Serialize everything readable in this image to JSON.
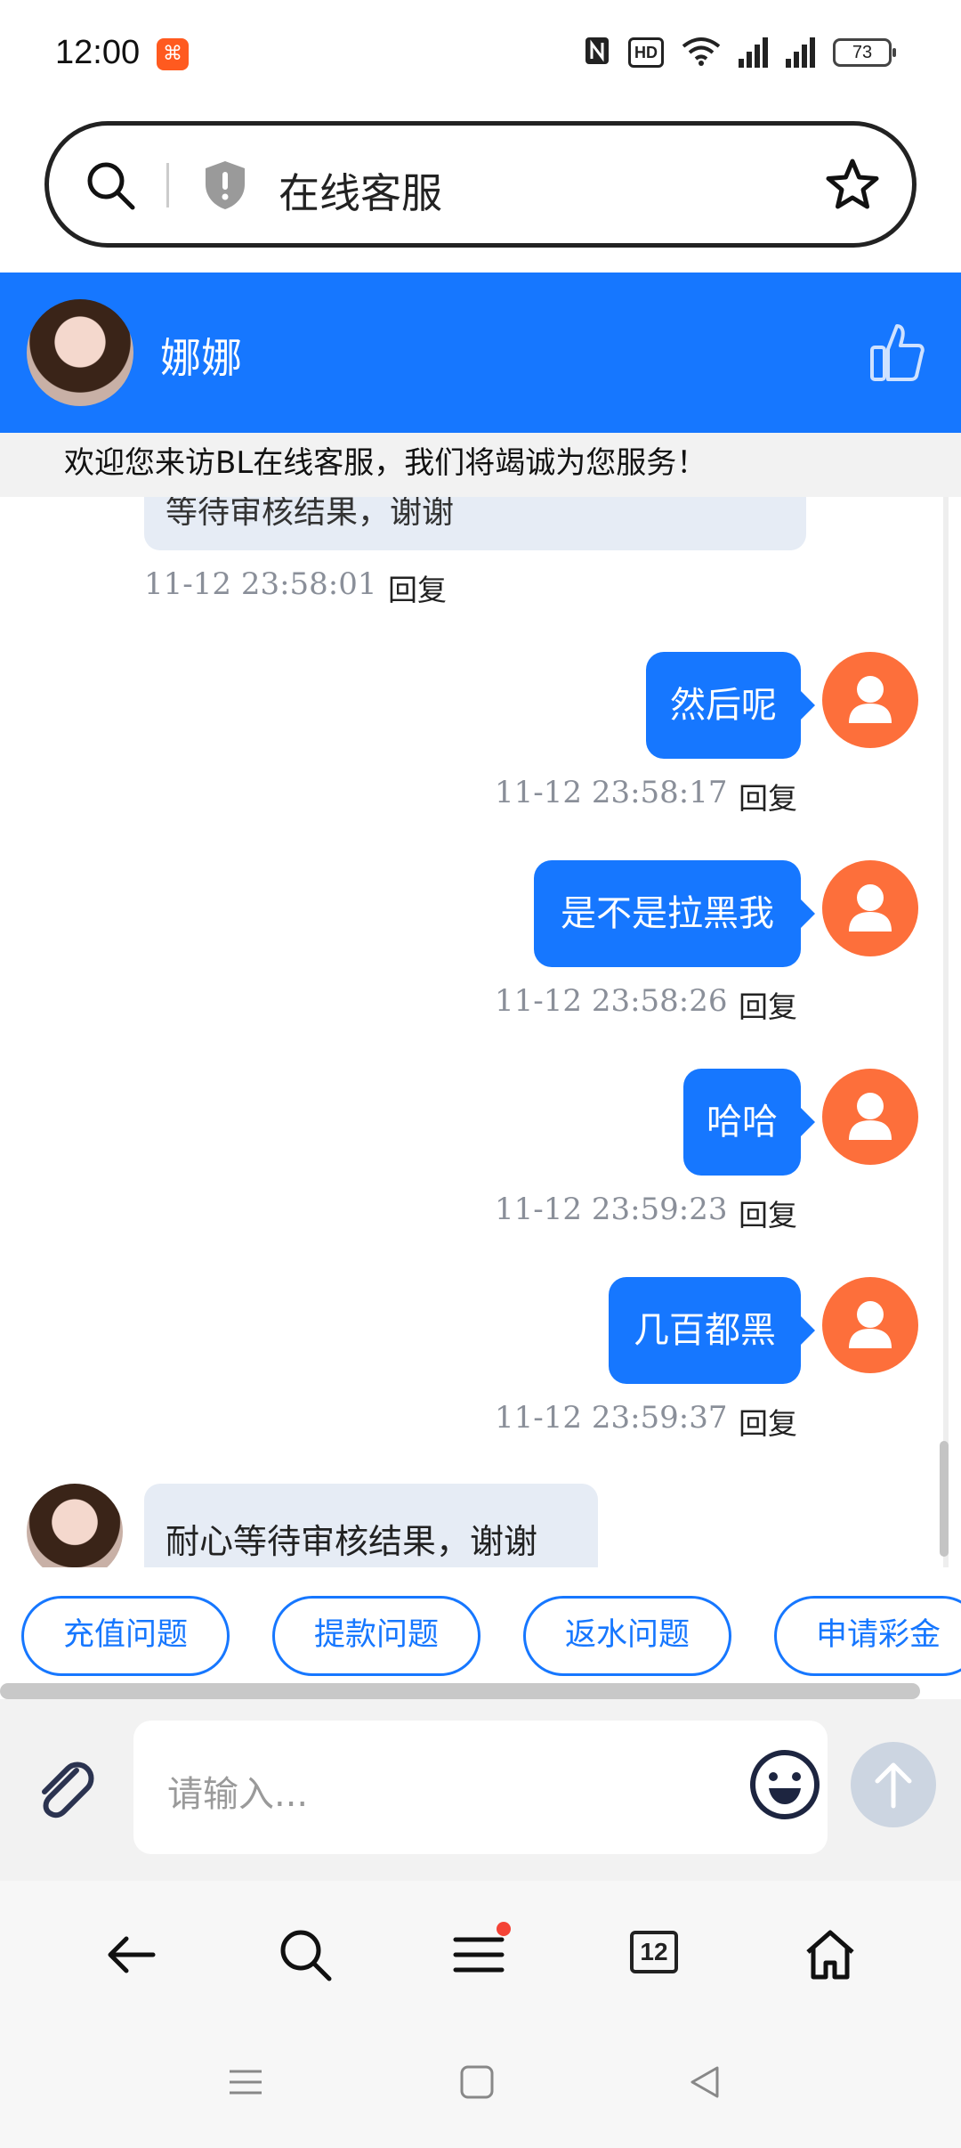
{
  "status_bar": {
    "time": "12:00",
    "hd_label": "HD",
    "battery": "73"
  },
  "address_bar": {
    "title": "在线客服"
  },
  "chat_header": {
    "agent_name": "娜娜"
  },
  "welcome_text": "欢迎您来访BL在线客服，我们将竭诚为您服务！",
  "partial_message": {
    "text": "等待审核结果，谢谢",
    "timestamp": "11-12 23:58:01",
    "reply_label": "回复"
  },
  "messages": [
    {
      "text": "然后呢",
      "timestamp": "11-12 23:58:17",
      "reply_label": "回复"
    },
    {
      "text": "是不是拉黑我",
      "timestamp": "11-12 23:58:26",
      "reply_label": "回复"
    },
    {
      "text": "哈哈",
      "timestamp": "11-12 23:59:23",
      "reply_label": "回复"
    },
    {
      "text": "几百都黑",
      "timestamp": "11-12 23:59:37",
      "reply_label": "回复"
    }
  ],
  "incoming_last": {
    "text": "耐心等待审核结果，谢谢"
  },
  "quick_replies": [
    "充值问题",
    "提款问题",
    "返水问题",
    "申请彩金"
  ],
  "input": {
    "placeholder": "请输入..."
  },
  "browser_nav": {
    "tab_count": "12"
  },
  "colors": {
    "accent": "#1677ff",
    "user_avatar": "#fd6f3b",
    "bubble_in": "#e6ecf5"
  }
}
